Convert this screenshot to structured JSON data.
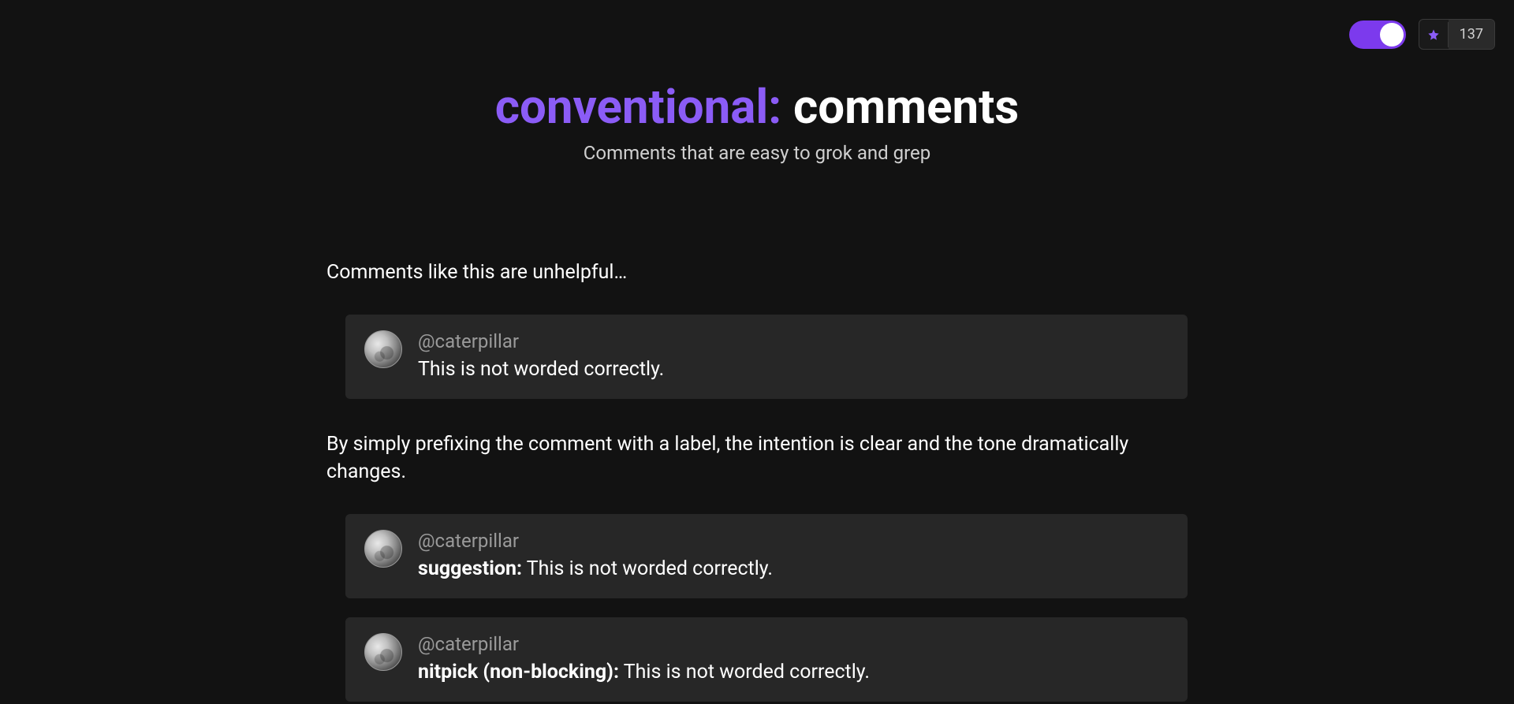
{
  "header": {
    "title_prefix": "conventional:",
    "title_suffix": " comments",
    "subtitle": "Comments that are easy to grok and grep"
  },
  "top": {
    "star_count": "137"
  },
  "content": {
    "intro": "Comments like this are unhelpful…",
    "between": "By simply prefixing the comment with a label, the intention is clear and the tone dramatically changes."
  },
  "comments": [
    {
      "author": "@caterpillar",
      "label": "",
      "text": "This is not worded correctly."
    },
    {
      "author": "@caterpillar",
      "label": "suggestion:",
      "text": " This is not worded correctly."
    },
    {
      "author": "@caterpillar",
      "label": "nitpick (non-blocking):",
      "text": " This is not worded correctly."
    }
  ]
}
